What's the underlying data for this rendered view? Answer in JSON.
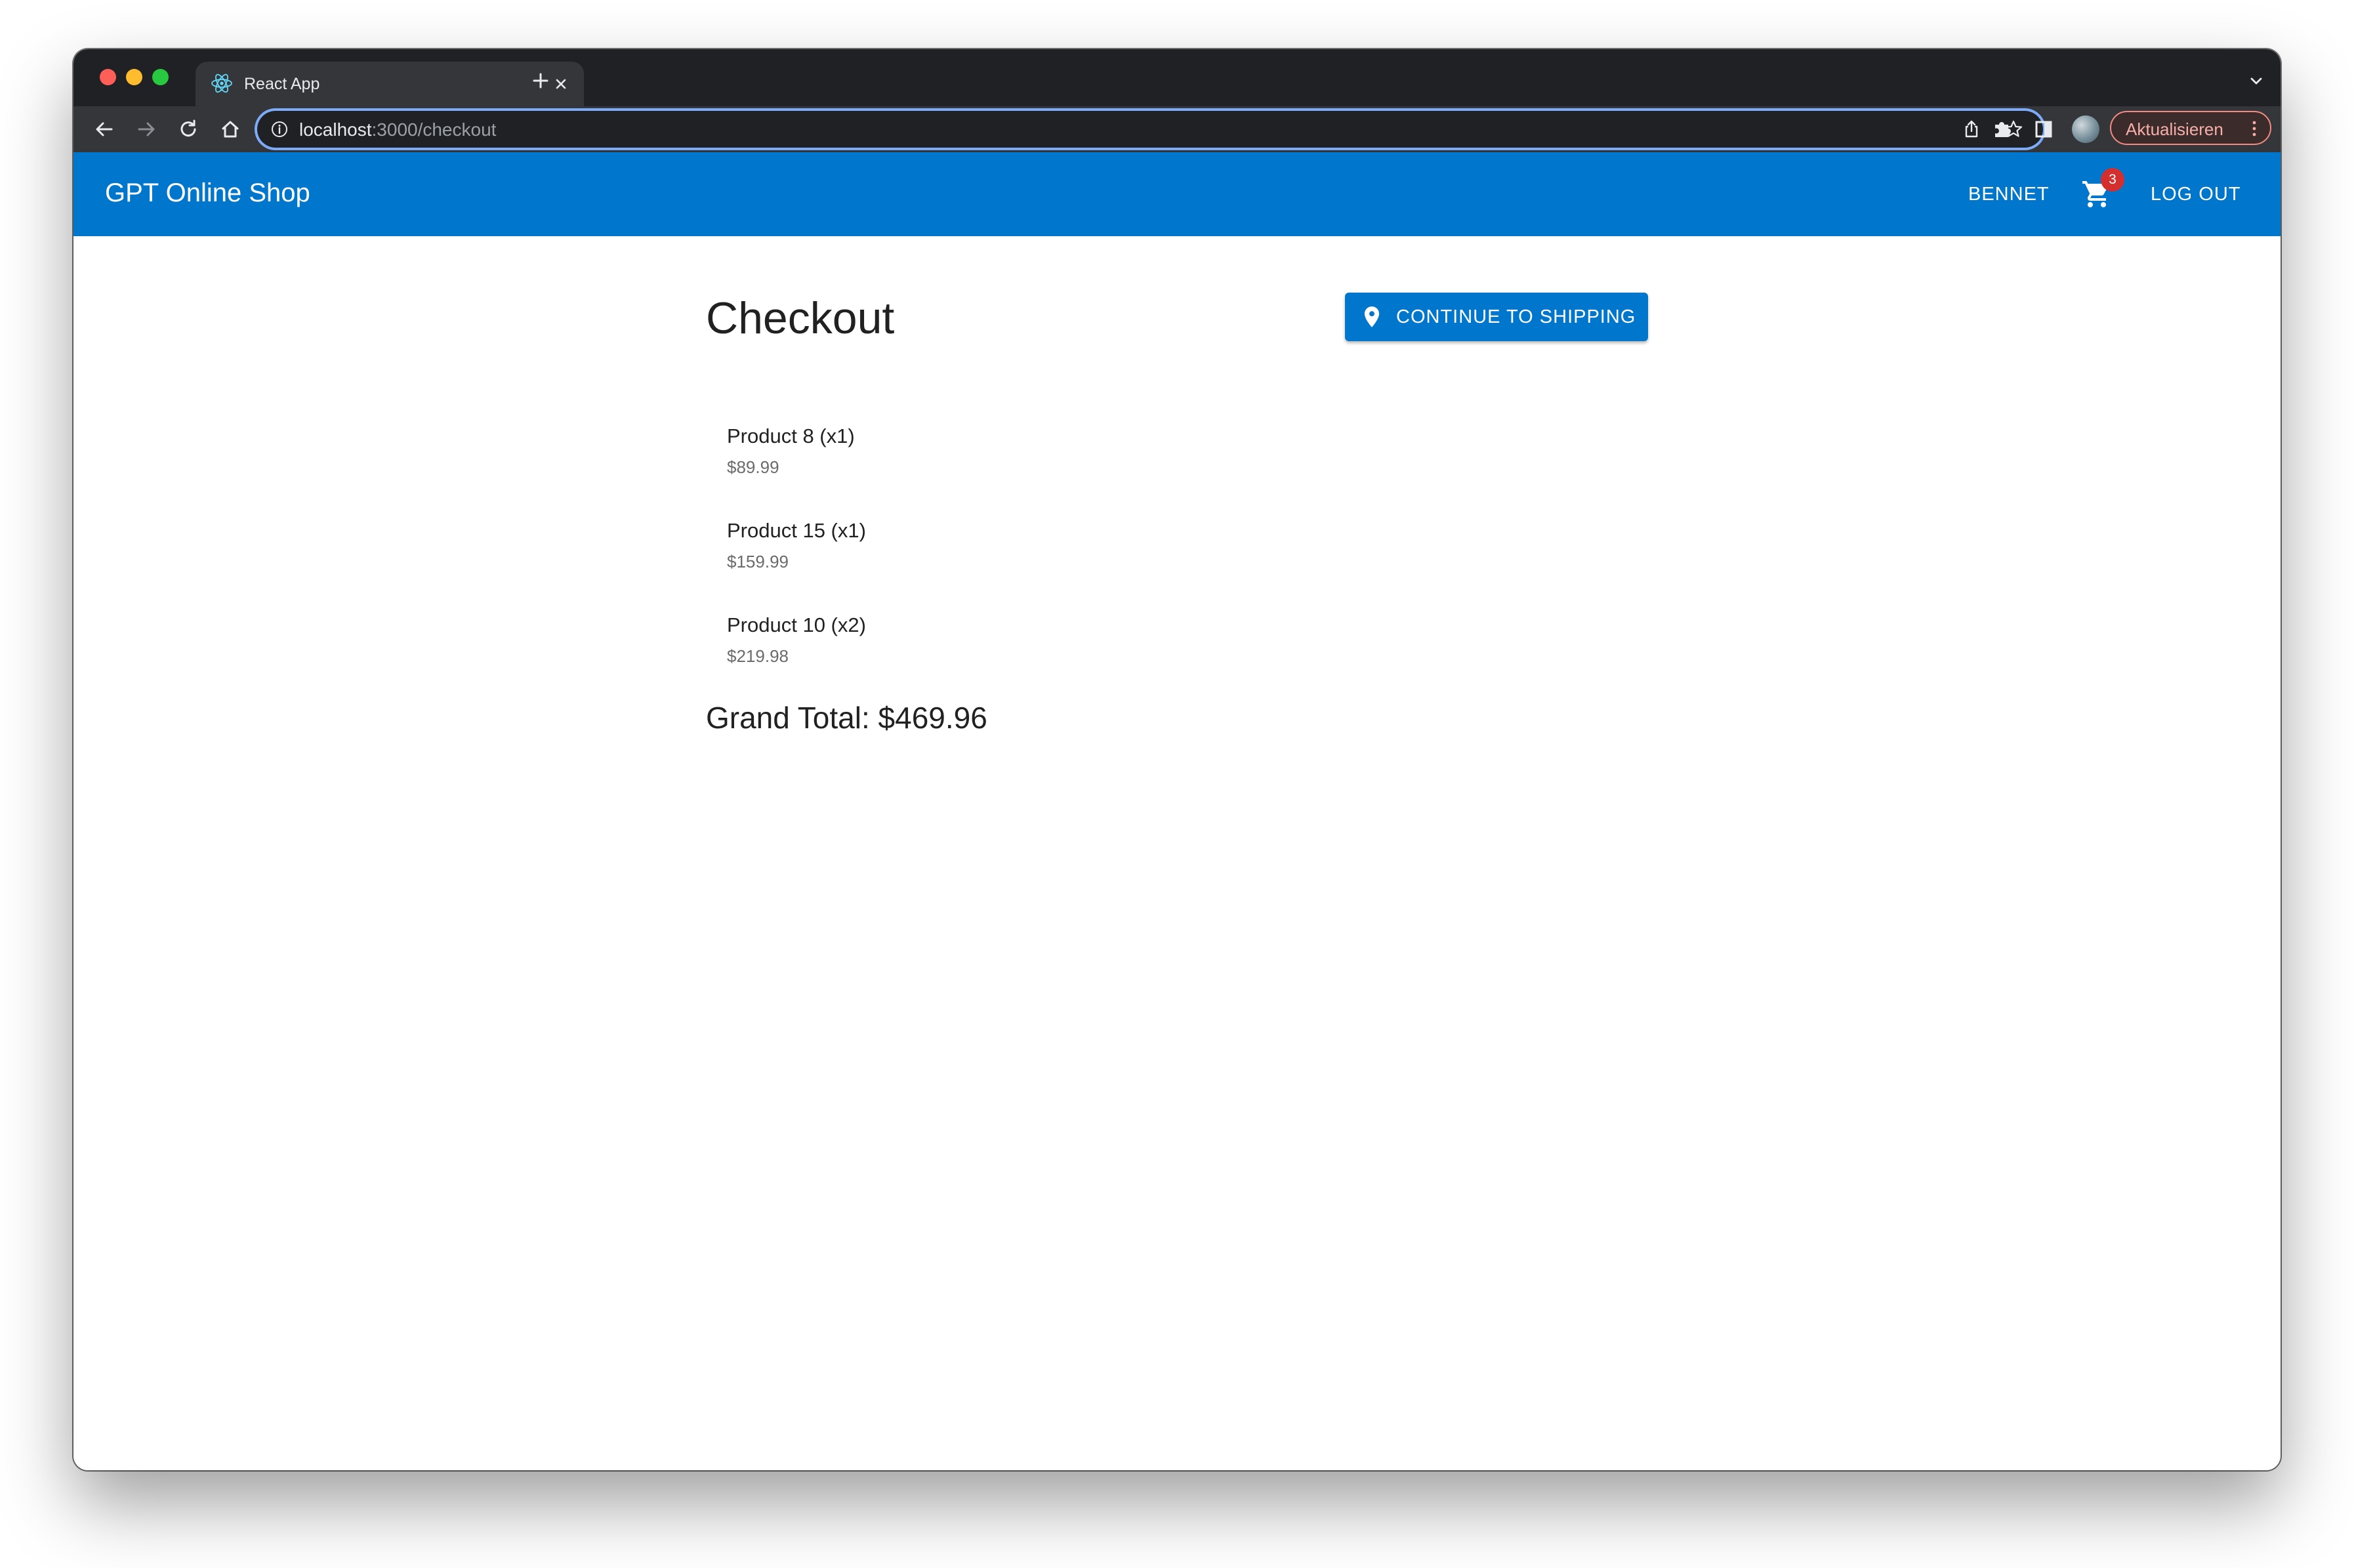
{
  "browser": {
    "tab_title": "React App",
    "url_host": "localhost",
    "url_path": ":3000/checkout",
    "update_label": "Aktualisieren"
  },
  "appbar": {
    "brand": "GPT Online Shop",
    "user": "BENNET",
    "cart_count": "3",
    "logout": "LOG OUT"
  },
  "checkout": {
    "title": "Checkout",
    "continue_label": "CONTINUE TO SHIPPING",
    "items": [
      {
        "name": "Product 8 (x1)",
        "price": "$89.99"
      },
      {
        "name": "Product 15 (x1)",
        "price": "$159.99"
      },
      {
        "name": "Product 10 (x2)",
        "price": "$219.98"
      }
    ],
    "grand_total": "Grand Total: $469.96"
  },
  "colors": {
    "primary": "#0077cc",
    "badge": "#d32f2f",
    "text": "#212121",
    "muted": "#6b6b6b"
  }
}
